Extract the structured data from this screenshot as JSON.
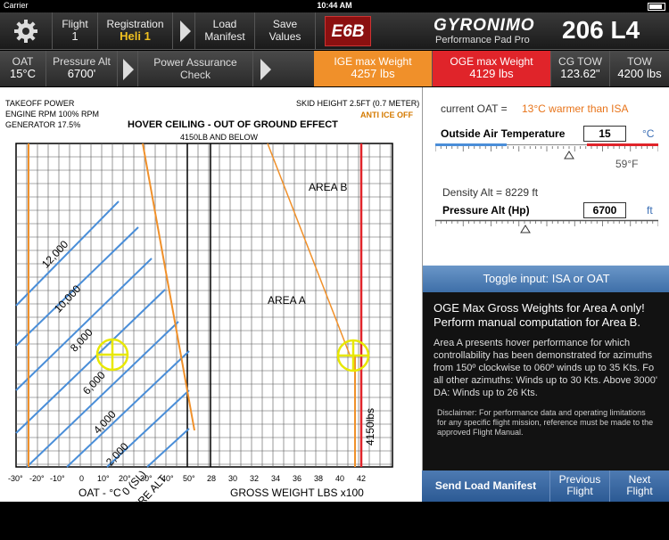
{
  "status": {
    "carrier": "Carrier",
    "time": "10:44 AM"
  },
  "topbar": {
    "flight_label": "Flight",
    "flight_value": "1",
    "registration_label": "Registration",
    "registration_value": "Heli 1",
    "load_manifest": "Load Manifest",
    "save_values": "Save Values",
    "e6b": "E6B",
    "logo": "GYRONIMO",
    "logo_sub": "Performance Pad Pro",
    "model": "206 L4"
  },
  "secondbar": {
    "oat_label": "OAT",
    "oat_value": "15°C",
    "palt_label": "Pressure Alt",
    "palt_value": "6700'",
    "power_check": "Power Assurance Check",
    "ige_label": "IGE max Weight",
    "ige_value": "4257 lbs",
    "oge_label": "OGE max Weight",
    "oge_value": "4129 lbs",
    "cgtow_label": "CG TOW",
    "cgtow_value": "123.62\"",
    "tow_label": "TOW",
    "tow_value": "4200 lbs"
  },
  "chart": {
    "header_left_1": "TAKEOFF POWER",
    "header_left_2": "ENGINE RPM 100% RPM",
    "header_left_3": "GENERATOR 17.5%",
    "header_right_1": "SKID HEIGHT 2.5FT (0.7 METER)",
    "header_right_2": "ANTI ICE OFF",
    "title": "HOVER CEILING - OUT OF GROUND EFFECT",
    "subtitle": "4150LB AND BELOW",
    "area_a": "AREA A",
    "area_b": "AREA B",
    "alt_labels": [
      "12,000",
      "10,000",
      "8,000",
      "6,000",
      "4,000",
      "2,000",
      "0 (SL)"
    ],
    "pressure_alt": "PRESSURE ALT",
    "weight_marker": "4150lbs",
    "oat_ticks": [
      "-30°",
      "-20°",
      "-10°",
      "0",
      "10°",
      "20°",
      "30°",
      "40°",
      "50°"
    ],
    "weight_ticks": [
      "28",
      "30",
      "32",
      "34",
      "36",
      "38",
      "40",
      "42"
    ],
    "oat_axis": "OAT - °C",
    "weight_axis": "GROSS WEIGHT LBS x100"
  },
  "panel": {
    "current_oat_label": "current OAT =",
    "current_oat_value": "13°C warmer than ISA",
    "oat_title": "Outside Air Temperature",
    "oat_value": "15",
    "oat_unit": "°C",
    "oat_f": "59°F",
    "density_alt": "Density Alt = 8229 ft",
    "palt_title": "Pressure Alt (Hp)",
    "palt_value": "6700",
    "palt_unit": "ft",
    "toggle": "Toggle input: ISA or OAT",
    "info_title": "OGE Max Gross Weights for Area A only! Perform manual computation for Area B.",
    "info_main": "Area A presents hover performance for which controllability has been demonstrated for azimuths from 150º clockwise to 060º winds up to 35 Kts. Fo all other azimuths: Winds up to 30 Kts. Above 3000' DA: Winds up to 26 Kts.",
    "disclaimer": "Disclaimer: For performance data and operating limitations for any specific flight mission, reference must be made to the approved Flight Manual.",
    "send": "Send Load Manifest",
    "prev": "Previous Flight",
    "next": "Next Flight"
  }
}
